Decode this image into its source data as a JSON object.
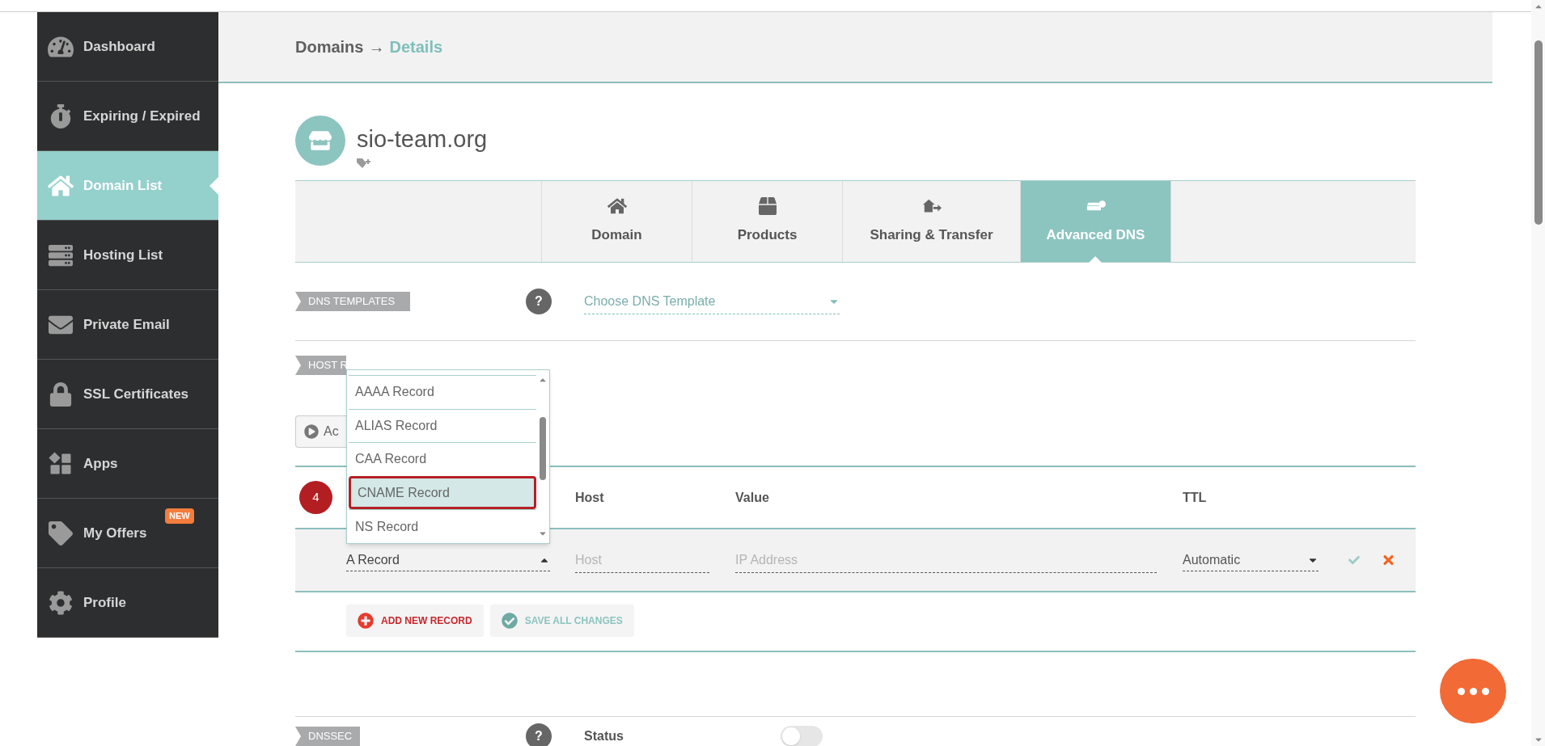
{
  "sidebar": {
    "items": [
      {
        "label": "Dashboard",
        "selected": false
      },
      {
        "label": "Expiring / Expired",
        "selected": false
      },
      {
        "label": "Domain List",
        "selected": true
      },
      {
        "label": "Hosting List",
        "selected": false
      },
      {
        "label": "Private Email",
        "selected": false
      },
      {
        "label": "SSL Certificates",
        "selected": false
      },
      {
        "label": "Apps",
        "selected": false
      },
      {
        "label": "My Offers",
        "selected": false,
        "badge": "NEW"
      },
      {
        "label": "Profile",
        "selected": false
      }
    ]
  },
  "breadcrumb": {
    "parent": "Domains",
    "separator": "→",
    "current": "Details"
  },
  "domain": {
    "name": "sio-team.org"
  },
  "tabs": [
    {
      "label": "Domain",
      "selected": false
    },
    {
      "label": "Products",
      "selected": false
    },
    {
      "label": "Sharing & Transfer",
      "selected": false
    },
    {
      "label": "Advanced DNS",
      "selected": true
    }
  ],
  "dns_templates": {
    "label": "DNS TEMPLATES",
    "help": "?",
    "select": {
      "value": "Choose DNS Template"
    }
  },
  "host_records": {
    "label": "HOST R",
    "action_button": "Ac",
    "dropdown": {
      "options": [
        {
          "label": "AAAA Record",
          "selected": false
        },
        {
          "label": "ALIAS Record",
          "selected": false
        },
        {
          "label": "CAA Record",
          "selected": false
        },
        {
          "label": "CNAME Record",
          "selected": true
        },
        {
          "label": "NS Record",
          "selected": false
        }
      ]
    },
    "step_marker": "4",
    "columns": [
      "Host",
      "Value",
      "TTL"
    ],
    "edit_row": {
      "type": "A Record",
      "host_placeholder": "Host",
      "value_placeholder": "IP Address",
      "ttl": "Automatic"
    },
    "buttons": [
      {
        "label": "ADD NEW RECORD",
        "kind": "add"
      },
      {
        "label": "SAVE ALL CHANGES",
        "kind": "save"
      }
    ]
  },
  "dnssec": {
    "label": "DNSSEC",
    "help": "?",
    "status_label": "Status",
    "enabled": false
  }
}
